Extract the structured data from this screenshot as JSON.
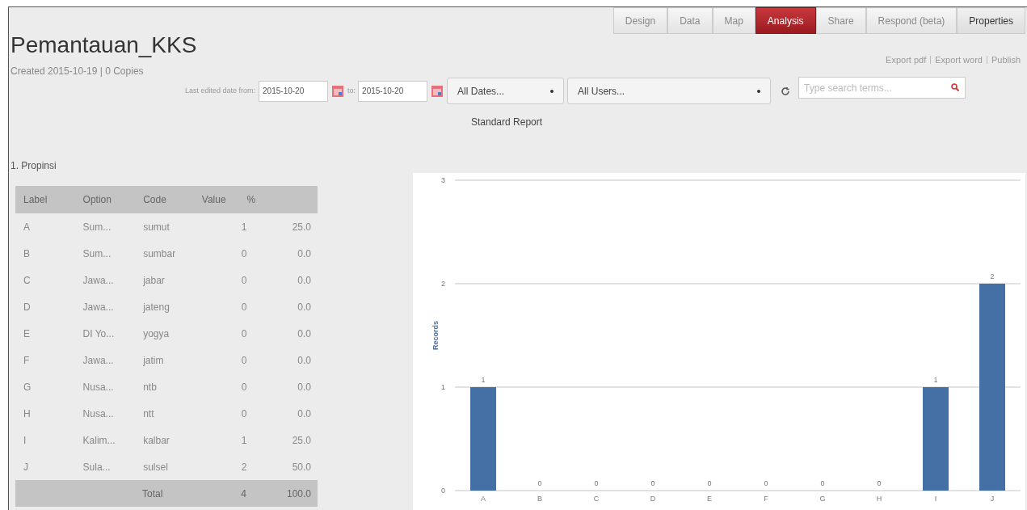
{
  "title": "Pemantauan_KKS",
  "subtitle": "Created 2015-10-19 | 0 Copies",
  "tabs": [
    {
      "label": "Design",
      "selected": false
    },
    {
      "label": "Data",
      "selected": false
    },
    {
      "label": "Map",
      "selected": false
    },
    {
      "label": "Analysis",
      "selected": true
    },
    {
      "label": "Share",
      "selected": false
    },
    {
      "label": "Respond (beta)",
      "selected": false
    },
    {
      "label": "Properties",
      "selected": false
    }
  ],
  "links": [
    "Export pdf",
    "Export word",
    "Publish"
  ],
  "filters": {
    "date_label": "Last edited date from:",
    "from": "2015-10-20",
    "to_label": "to:",
    "to": "2015-10-20",
    "dates": "All Dates...",
    "users": "All Users...",
    "search_placeholder": "Type search terms..."
  },
  "report_title": "Standard Report",
  "question": "1. Propinsi",
  "table": {
    "columns": [
      "Label",
      "Option",
      "Code",
      "Value",
      "%"
    ],
    "rows": [
      [
        "A",
        "Sum...",
        "sumut",
        "1",
        "25.0"
      ],
      [
        "B",
        "Sum...",
        "sumbar",
        "0",
        "0.0"
      ],
      [
        "C",
        "Jawa...",
        "jabar",
        "0",
        "0.0"
      ],
      [
        "D",
        "Jawa...",
        "jateng",
        "0",
        "0.0"
      ],
      [
        "E",
        "DI Yo...",
        "yogya",
        "0",
        "0.0"
      ],
      [
        "F",
        "Jawa...",
        "jatim",
        "0",
        "0.0"
      ],
      [
        "G",
        "Nusa...",
        "ntb",
        "0",
        "0.0"
      ],
      [
        "H",
        "Nusa...",
        "ntt",
        "0",
        "0.0"
      ],
      [
        "I",
        "Kalim...",
        "kalbar",
        "1",
        "25.0"
      ],
      [
        "J",
        "Sula...",
        "sulsel",
        "2",
        "50.0"
      ]
    ],
    "total": [
      "Total",
      "4",
      "100.0"
    ]
  },
  "chart_data": {
    "type": "bar",
    "ylabel": "Records",
    "categories": [
      "A",
      "B",
      "C",
      "D",
      "E",
      "F",
      "G",
      "H",
      "I",
      "J"
    ],
    "series": [
      {
        "color": "#4470a6",
        "values": [
          1,
          0,
          0,
          0,
          0,
          0,
          0,
          0,
          1,
          2
        ]
      }
    ],
    "ylim": [
      0,
      3
    ],
    "yticks": [
      0,
      1,
      2,
      3
    ],
    "data_labels": true
  }
}
